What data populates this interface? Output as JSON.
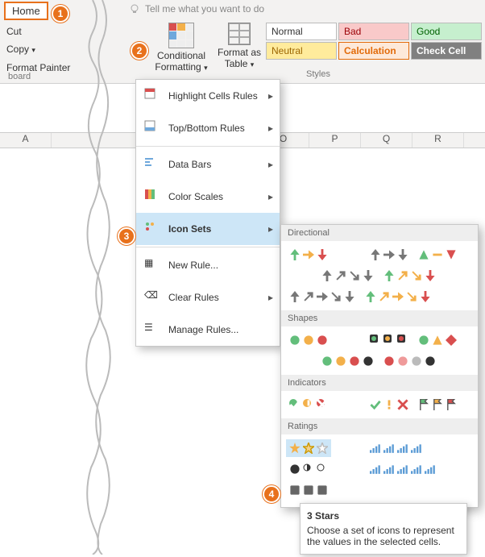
{
  "tabs": {
    "home": "Home"
  },
  "tell_me": "Tell me what you want to do",
  "clipboard": {
    "cut": "Cut",
    "copy": "Copy",
    "painter": "Format Painter",
    "label": "board"
  },
  "cf": {
    "label_l1": "Conditional",
    "label_l2": "Formatting"
  },
  "ft": {
    "label_l1": "Format as",
    "label_l2": "Table"
  },
  "styles": {
    "normal": {
      "t": "Normal",
      "bg": "#ffffff",
      "fg": "#333",
      "bd": "#bbb"
    },
    "bad": {
      "t": "Bad",
      "bg": "#f9c9c9",
      "fg": "#9c0006"
    },
    "good": {
      "t": "Good",
      "bg": "#c6efce",
      "fg": "#006100"
    },
    "neutral": {
      "t": "Neutral",
      "bg": "#ffeb9c",
      "fg": "#9c6500"
    },
    "calculation": {
      "t": "Calculation",
      "bg": "#fde9d9",
      "fg": "#e26b0a",
      "bd": "#e26b0a"
    },
    "checkcell": {
      "t": "Check Cell",
      "bg": "#808080",
      "fg": "#ffffff"
    }
  },
  "styles_label": "Styles",
  "cols": [
    "A",
    "",
    "",
    "",
    "",
    "O",
    "P",
    "Q",
    "R"
  ],
  "dd": {
    "hcr": "Highlight Cells Rules",
    "tbr": "Top/Bottom Rules",
    "db": "Data Bars",
    "cs": "Color Scales",
    "is": "Icon Sets",
    "nr": "New Rule...",
    "cr": "Clear Rules",
    "mr": "Manage Rules..."
  },
  "cats": {
    "dir": "Directional",
    "shp": "Shapes",
    "ind": "Indicators",
    "rat": "Ratings"
  },
  "tooltip": {
    "title": "3 Stars",
    "body": "Choose a set of icons to represent the values in the selected cells."
  },
  "callouts": {
    "1": "1",
    "2": "2",
    "3": "3",
    "4": "4"
  }
}
